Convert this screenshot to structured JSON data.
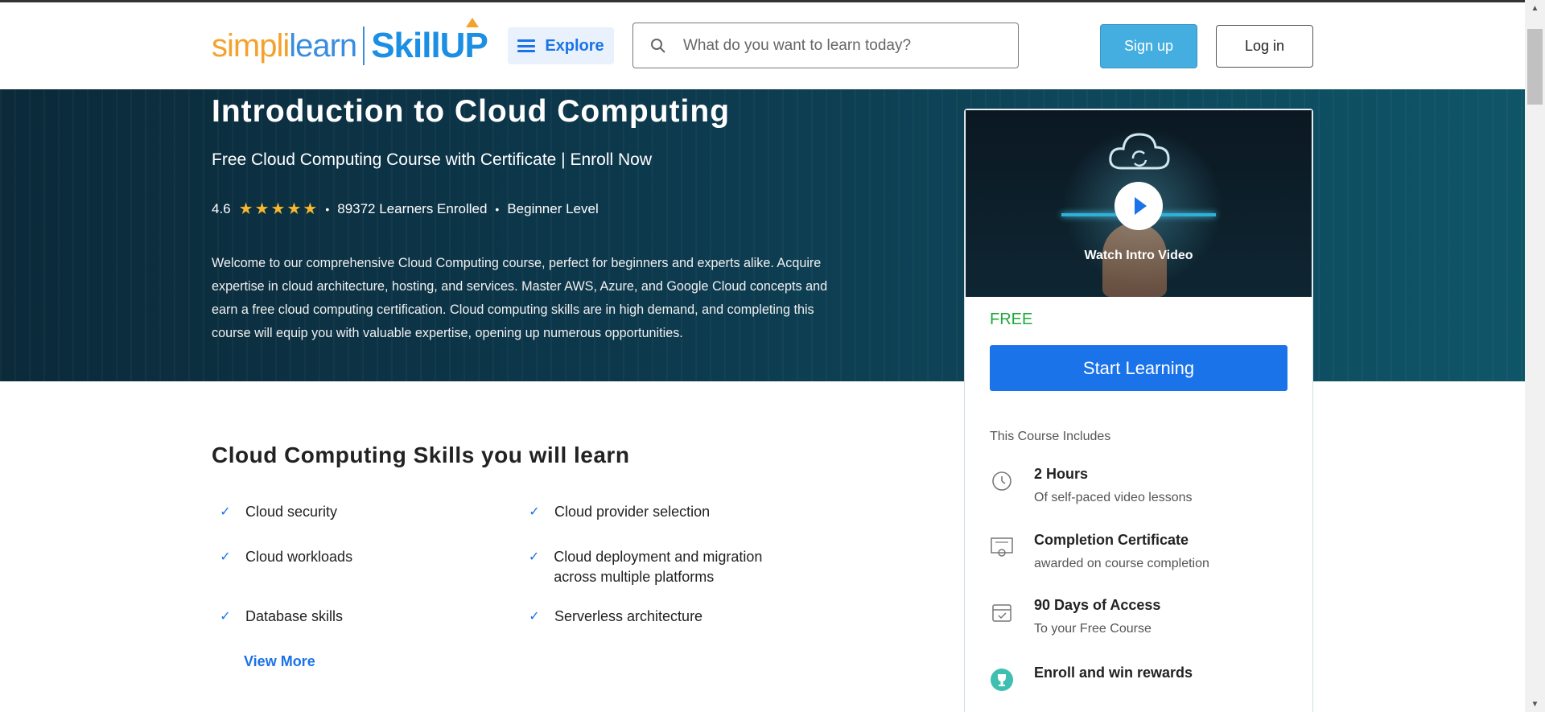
{
  "header": {
    "logo_part1": "simpli",
    "logo_part2": "learn",
    "logo_part3": "SkillUP",
    "explore_label": "Explore",
    "search_placeholder": "What do you want to learn today?",
    "signup_label": "Sign up",
    "login_label": "Log in"
  },
  "hero": {
    "title": "Introduction to Cloud Computing",
    "subtitle": "Free Cloud Computing Course with Certificate | Enroll Now",
    "rating": "4.6",
    "stars": 5,
    "learners": "89372 Learners Enrolled",
    "level": "Beginner Level",
    "description": "Welcome to our comprehensive Cloud Computing course, perfect for beginners and experts alike. Acquire expertise in cloud architecture, hosting, and services. Master AWS, Azure, and Google Cloud concepts and earn a free cloud computing certification. Cloud computing skills are in high demand, and completing this course will equip you with valuable expertise, opening up numerous opportunities."
  },
  "card": {
    "video_label": "Watch Intro Video",
    "price": "FREE",
    "start_label": "Start Learning",
    "includes_title": "This Course Includes",
    "items": [
      {
        "title": "2 Hours",
        "sub": "Of self-paced video lessons",
        "icon": "clock-icon"
      },
      {
        "title": "Completion Certificate",
        "sub": "awarded on course completion",
        "icon": "certificate-icon"
      },
      {
        "title": "90 Days of Access",
        "sub": "To your Free Course",
        "icon": "calendar-icon"
      },
      {
        "title": "Enroll and win rewards",
        "sub": "",
        "icon": "trophy-icon"
      }
    ]
  },
  "skills": {
    "title": "Cloud Computing Skills you will learn",
    "items": [
      "Cloud security",
      "Cloud provider selection",
      "Cloud workloads",
      "Cloud deployment and migration across multiple platforms",
      "Database skills",
      "Serverless architecture"
    ],
    "view_more": "View More"
  },
  "colors": {
    "brand_blue": "#1a73e8",
    "signup_blue": "#44aee0",
    "free_green": "#1fa83c",
    "star_gold": "#f5b82e",
    "hero_dark": "#0b2a3a"
  }
}
